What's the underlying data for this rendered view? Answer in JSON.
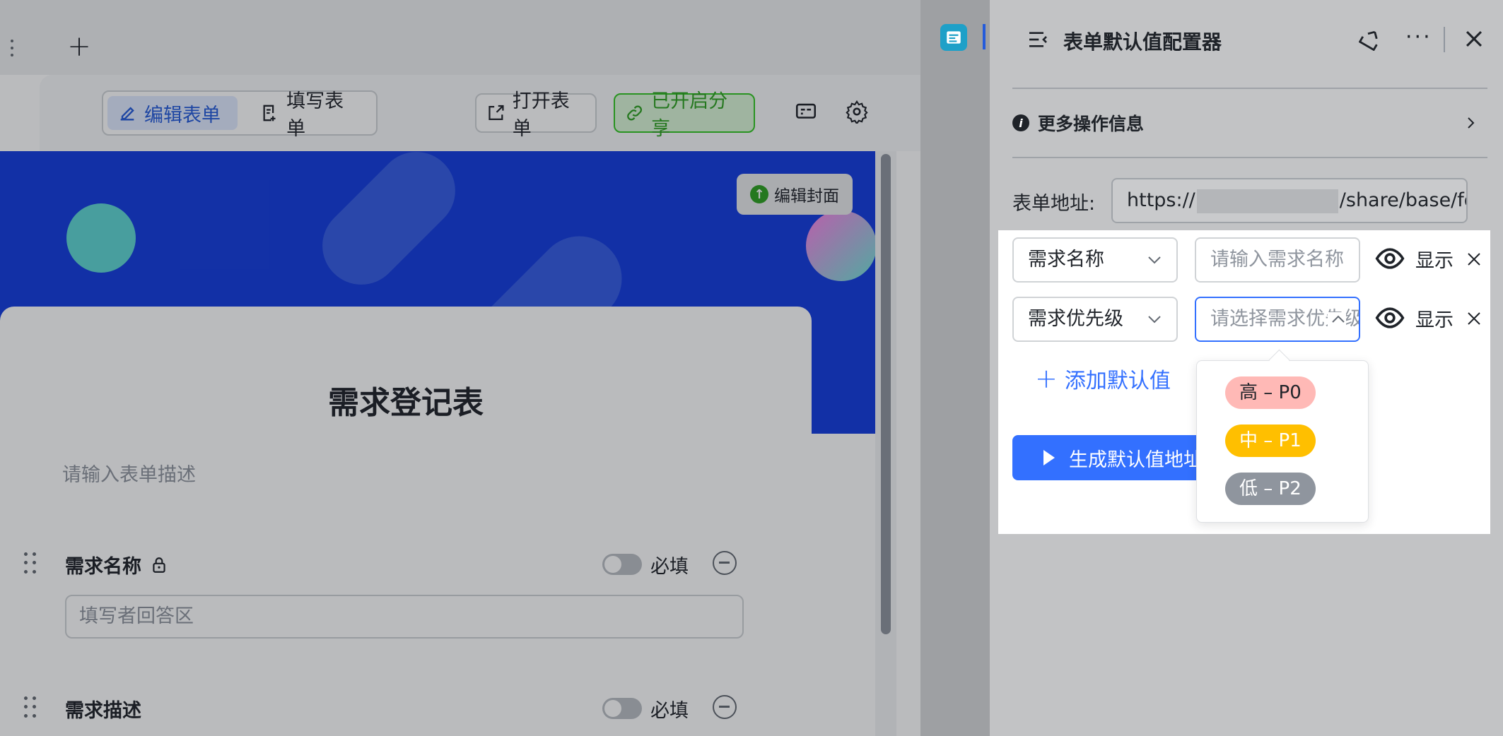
{
  "editor": {
    "toolbar": {
      "edit_form": "编辑表单",
      "fill_form": "填写表单",
      "open_form": "打开表单",
      "share_status": "已开启分享"
    },
    "cover": {
      "edit_cover": "编辑封面"
    },
    "form": {
      "title": "需求登记表",
      "description_placeholder": "请输入表单描述",
      "fields": [
        {
          "label": "需求名称",
          "required_label": "必填",
          "answer_placeholder": "填写者回答区"
        },
        {
          "label": "需求描述",
          "required_label": "必填"
        }
      ]
    }
  },
  "panel": {
    "title": "表单默认值配置器",
    "more_info": "更多操作信息",
    "url_label": "表单地址:",
    "url_prefix": "https://",
    "url_suffix": "/share/base/for",
    "rows": [
      {
        "field": "需求名称",
        "value_placeholder": "请输入需求名称",
        "visibility": "显示"
      },
      {
        "field": "需求优先级",
        "value_placeholder": "请选择需求优先级",
        "visibility": "显示"
      }
    ],
    "add_default": "添加默认值",
    "generate": "生成默认值地址",
    "priority_options": [
      {
        "label": "高 – P0",
        "bg": "#ffb9b6",
        "fg": "#1f2329"
      },
      {
        "label": "中 – P1",
        "bg": "#ffbf00",
        "fg": "#ffffff"
      },
      {
        "label": "低 – P2",
        "bg": "#8f959e",
        "fg": "#ffffff"
      }
    ]
  },
  "colors": {
    "primary": "#3370ff",
    "cover_blue": "#133cdf",
    "share_green": "#2ea121"
  }
}
